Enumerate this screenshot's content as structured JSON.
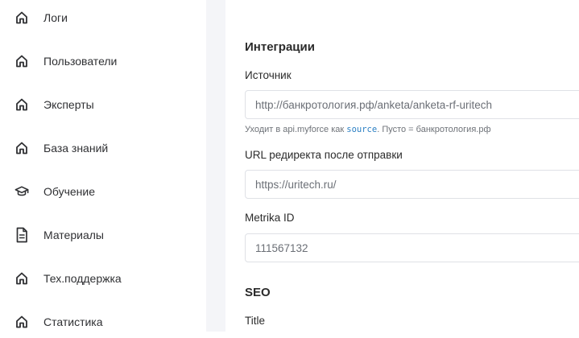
{
  "sidebar": {
    "items": [
      {
        "label": "Логи",
        "icon": "home-icon"
      },
      {
        "label": "Пользователи",
        "icon": "home-icon"
      },
      {
        "label": "Эксперты",
        "icon": "home-icon"
      },
      {
        "label": "База знаний",
        "icon": "home-icon"
      },
      {
        "label": "Обучение",
        "icon": "graduation-cap-icon"
      },
      {
        "label": "Материалы",
        "icon": "document-icon"
      },
      {
        "label": "Тех.поддержка",
        "icon": "home-icon"
      },
      {
        "label": "Статистика",
        "icon": "home-icon"
      }
    ]
  },
  "integrations": {
    "title": "Интеграции",
    "source": {
      "label": "Источник",
      "value": "http://банкротология.рф/anketa/anketa-rf-uritech",
      "hint_prefix": "Уходит в api.myforce как ",
      "hint_code": "source",
      "hint_suffix": ". Пусто = банкротология.рф"
    },
    "redirect": {
      "label": "URL редиректа после отправки",
      "value": "https://uritech.ru/"
    },
    "metrika": {
      "label": "Metrika ID",
      "value": "111567132"
    }
  },
  "seo": {
    "title": "SEO",
    "title_field_label": "Title"
  },
  "colors": {
    "gutter": "#f4f5f8",
    "input_border": "#dfe1e6",
    "code_accent": "#2b7fc3"
  }
}
